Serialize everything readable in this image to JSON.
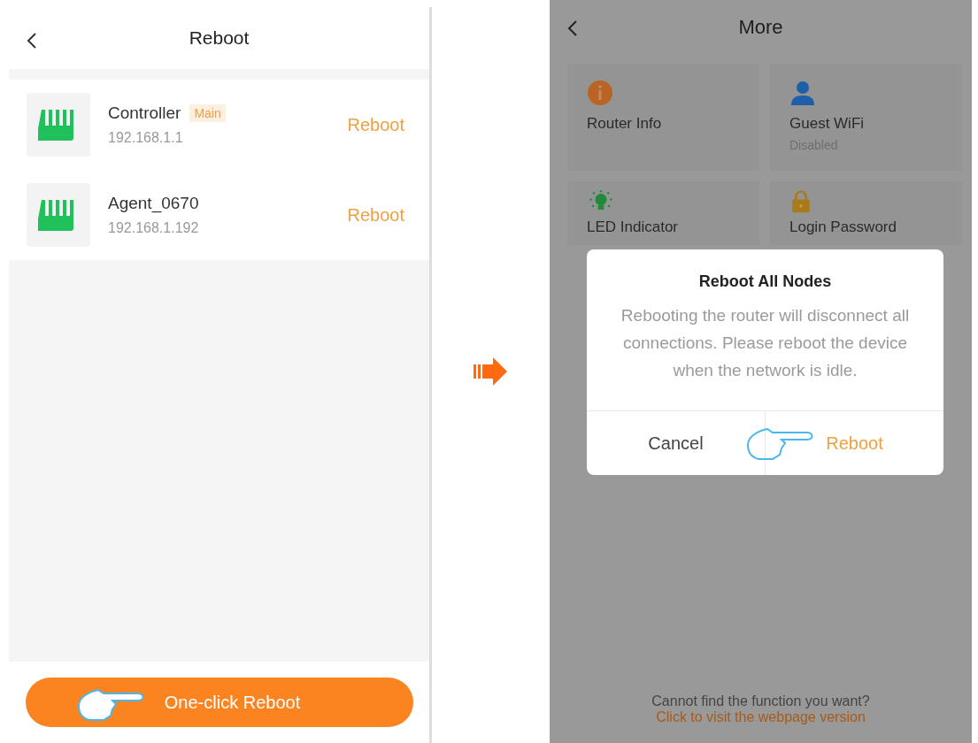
{
  "reboot_screen": {
    "title": "Reboot",
    "devices": [
      {
        "name": "Controller",
        "badge": "Main",
        "ip": "192.168.1.1",
        "action": "Reboot"
      },
      {
        "name": "Agent_0670",
        "ip": "192.168.1.192",
        "action": "Reboot"
      }
    ],
    "one_click_button": "One-click Reboot"
  },
  "more_screen": {
    "title": "More",
    "cards": [
      {
        "kind": "info",
        "label": "Router Info"
      },
      {
        "kind": "user",
        "label": "Guest WiFi",
        "status": "Disabled"
      },
      {
        "kind": "bulb",
        "label": "LED Indicator"
      },
      {
        "kind": "lock",
        "label": "Login Password"
      }
    ],
    "footer": {
      "text": "Cannot find the function you want?",
      "link": "Click to visit the webpage version"
    },
    "dialog": {
      "title": "Reboot All Nodes",
      "message": "Rebooting the router will disconnect all connections. Please reboot the device when the network is idle.",
      "buttons": [
        {
          "kind": "cancel",
          "label": "Cancel"
        },
        {
          "kind": "confirm",
          "label": "Reboot"
        }
      ]
    }
  }
}
